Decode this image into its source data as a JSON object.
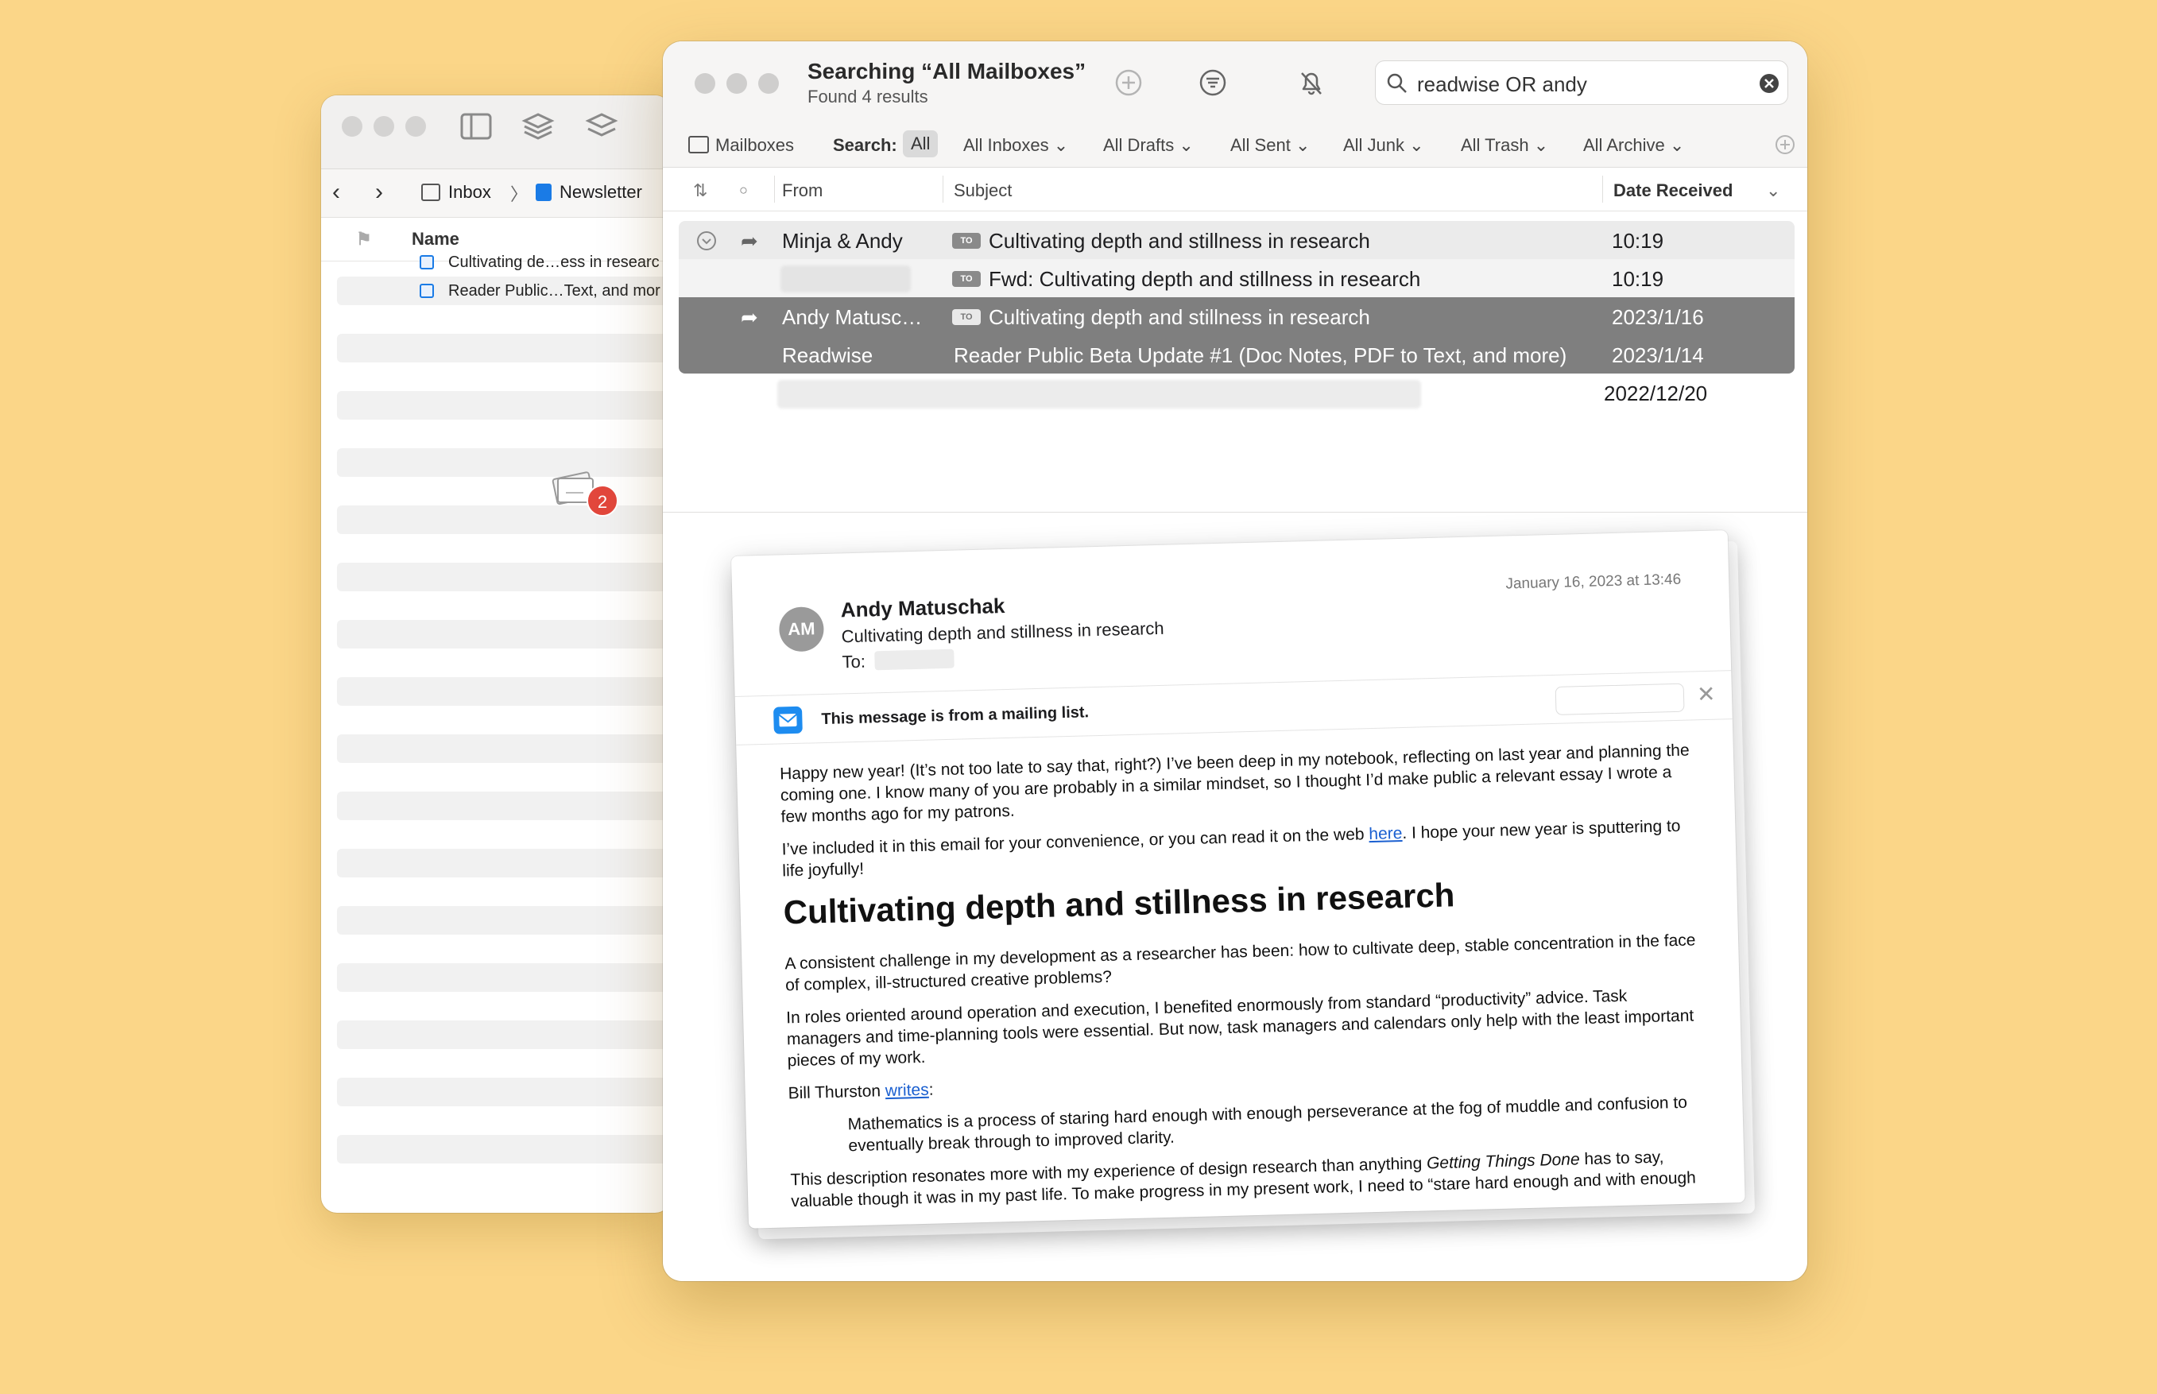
{
  "finder": {
    "path": [
      "Inbox",
      "Newsletter"
    ],
    "column_header": "Name",
    "files": [
      "Cultivating de…ess in researc",
      "Reader Public…Text, and mor"
    ],
    "drag_badge": "2"
  },
  "mail": {
    "title": "Searching “All Mailboxes”",
    "subtitle": "Found 4 results",
    "search_query": "readwise OR andy",
    "scope": {
      "mailboxes": "Mailboxes",
      "search_label": "Search:",
      "all": "All",
      "items": [
        "All Inboxes",
        "All Drafts",
        "All Sent",
        "All Junk",
        "All Trash",
        "All Archive"
      ]
    },
    "columns": {
      "from": "From",
      "subject": "Subject",
      "date": "Date Received"
    },
    "messages": [
      {
        "from": "Minja & Andy",
        "tag": "TO",
        "subject": "Cultivating depth and stillness in research",
        "date": "10:19"
      },
      {
        "from": "",
        "tag": "TO",
        "subject": "Fwd: Cultivating depth and stillness in research",
        "date": "10:19"
      },
      {
        "from": "Andy Matusc…",
        "tag": "TO",
        "subject": "Cultivating depth and stillness in research",
        "date": "2023/1/16"
      },
      {
        "from": "Readwise",
        "tag": "",
        "subject": "Reader Public Beta Update #1 (Doc Notes, PDF to Text, and more)",
        "date": "2023/1/14"
      },
      {
        "from": "",
        "tag": "",
        "subject": "",
        "date": "2022/12/20"
      }
    ]
  },
  "preview": {
    "avatar": "AM",
    "from": "Andy Matuschak",
    "subject": "Cultivating depth and stillness in research",
    "to_label": "To:",
    "date": "January 16, 2023 at 13:46",
    "banner": "This message is from a mailing list.",
    "p1": "Happy new year! (It’s not too late to say that, right?) I’ve been deep in my notebook, reflecting on last year and planning the coming one. I know many of you are probably in a similar mindset, so I thought I’d make public a relevant essay I wrote a few months ago for my patrons.",
    "p2_before": "I’ve included it in this email for your convenience, or you can read it on the web ",
    "p2_link": "here",
    "p2_after": ". I hope your new year is sputtering to life joyfully!",
    "heading": "Cultivating depth and stillness in research",
    "p3": "A consistent challenge in my development as a researcher has been: how to cultivate deep, stable concentration in the face of complex, ill-structured creative problems?",
    "p4": "In roles oriented around operation and execution, I benefited enormously from standard “productivity” advice. Task managers and time-planning tools were essential. But now, task managers and calendars only help with the least important pieces of my work.",
    "p5_before": "Bill Thurston ",
    "p5_link": "writes",
    "p5_after": ":",
    "quote": "Mathematics is a process of staring hard enough with enough perseverance at the fog of muddle and confusion to eventually break through to improved clarity.",
    "p6_before": "This description resonates more with my experience of design research than anything ",
    "p6_italic": "Getting Things Done",
    "p6_after": " has to say, valuable though it was in my past life. To make progress in my present work, I need to “stare hard enough and with enough"
  }
}
